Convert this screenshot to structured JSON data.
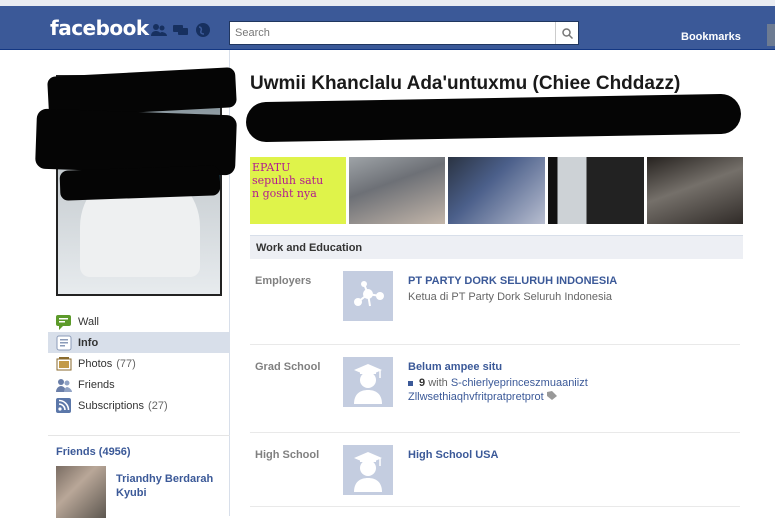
{
  "topbar": {
    "logo": "facebook",
    "search_placeholder": "Search",
    "bookmarks": "Bookmarks"
  },
  "profile": {
    "name": "Uwmii Khanclalu Ada'untuxmu (Chiee Chddazz)"
  },
  "photo_strip": {
    "caption_1": "EPATU\nsepuluh satu\nn gosht nya"
  },
  "nav": {
    "items": [
      {
        "label": "Wall",
        "count": ""
      },
      {
        "label": "Info",
        "count": ""
      },
      {
        "label": "Photos",
        "count": "(77)"
      },
      {
        "label": "Friends",
        "count": ""
      },
      {
        "label": "Subscriptions",
        "count": "(27)"
      }
    ]
  },
  "friends": {
    "heading": "Friends (4956)",
    "first_name": "Triandhy Berdarah Kyubi"
  },
  "info": {
    "section_title": "Work and Education",
    "employers": {
      "label": "Employers",
      "title": "PT PARTY DORK SELURUH INDONESIA",
      "subtitle": "Ketua di PT Party Dork Seluruh Indonesia"
    },
    "grad_school": {
      "label": "Grad School",
      "title": "Belum ampee situ",
      "with_count": "9",
      "with_text": "with",
      "with_names": "S-chierlyeprinceszmuaaniizt Zllwsethiaqhvfritpratpretprot"
    },
    "high_school": {
      "label": "High School",
      "title": "High School USA"
    }
  },
  "colors": {
    "brand": "#3b5998",
    "active_nav": "#d8dfea"
  }
}
